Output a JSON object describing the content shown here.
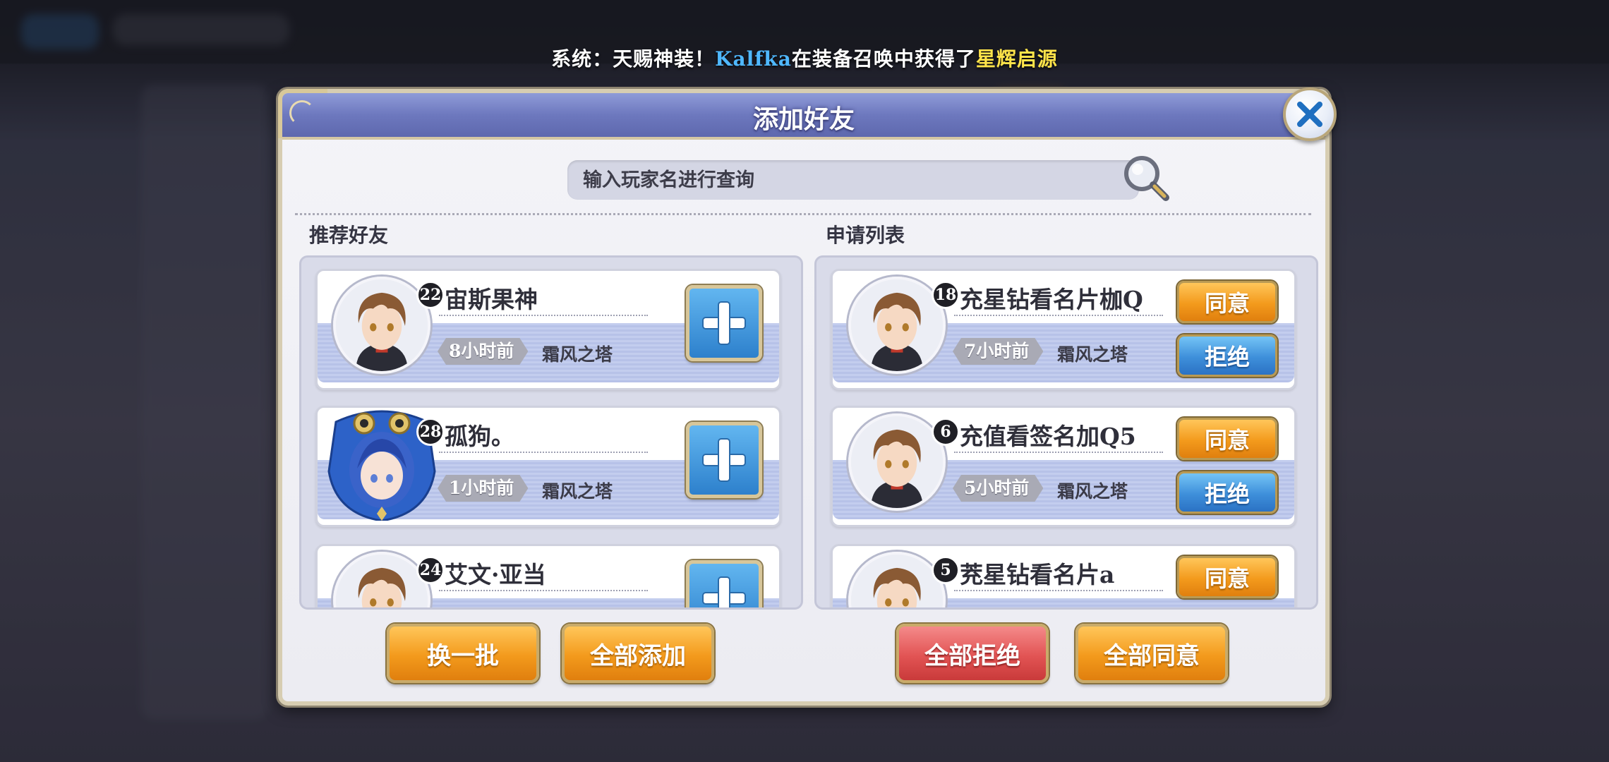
{
  "marquee": {
    "prefix": "系统：天赐神装！",
    "player": "Kalfka",
    "middle": "在装备召唤中获得了",
    "item": "星辉启源"
  },
  "dialog": {
    "title": "添加好友",
    "close_icon": "close-icon"
  },
  "search": {
    "placeholder": "输入玩家名进行查询",
    "value": "",
    "icon": "magnifier-icon"
  },
  "recommended": {
    "title": "推荐好友",
    "items": [
      {
        "name": "宙斯果神",
        "level": "22",
        "time": "8小时前",
        "server": "霜风之塔",
        "avatar": "brown-hair-boy-portrait"
      },
      {
        "name": "孤狗。",
        "level": "28",
        "time": "1小时前",
        "server": "霜风之塔",
        "avatar": "blue-hair-girl-owl-frame-portrait"
      },
      {
        "name": "艾文·亚当",
        "level": "24",
        "time": "",
        "server": "",
        "avatar": "brown-hair-boy-portrait"
      }
    ],
    "buttons": {
      "refresh": "换一批",
      "add_all": "全部添加"
    }
  },
  "requests": {
    "title": "申请列表",
    "items": [
      {
        "name": "充星钻看名片枷Q",
        "level": "18",
        "time": "7小时前",
        "server": "霜风之塔",
        "accept": "同意",
        "reject": "拒绝",
        "avatar": "brown-hair-boy-portrait"
      },
      {
        "name": "充值看签名加Q5",
        "level": "6",
        "time": "5小时前",
        "server": "霜风之塔",
        "accept": "同意",
        "reject": "拒绝",
        "avatar": "brown-hair-boy-portrait"
      },
      {
        "name": "茺星钻看名片a",
        "level": "5",
        "time": "",
        "server": "",
        "accept": "同意",
        "reject": "",
        "avatar": "brown-hair-boy-portrait"
      }
    ],
    "buttons": {
      "reject_all": "全部拒绝",
      "accept_all": "全部同意"
    }
  },
  "colors": {
    "title_bar": "#6d78be",
    "player_name": "#4fb8ff",
    "item_name": "#ffe44a",
    "orange_button": "#f39a1c",
    "blue_button": "#3e8fda",
    "red_button": "#e25454"
  }
}
